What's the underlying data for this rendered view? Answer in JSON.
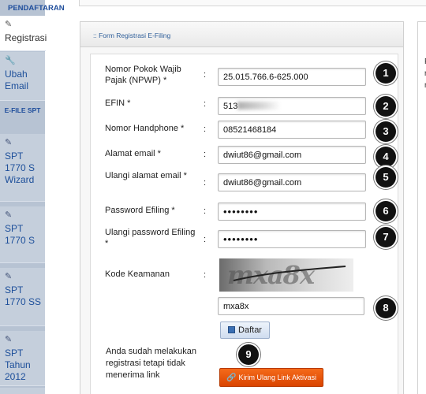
{
  "sidebar": {
    "header": "PENDAFTARAN",
    "items": [
      {
        "icon": "edit-icon",
        "label": "Registrasi",
        "active": true
      },
      {
        "icon": "wrench-icon",
        "label": "Ubah Email",
        "active": false
      },
      {
        "icon": "edit-icon",
        "label": "SPT 1770 S Wizard",
        "active": false
      },
      {
        "icon": "edit-icon",
        "label": "SPT 1770 S",
        "active": false
      },
      {
        "icon": "edit-icon",
        "label": "SPT 1770 SS",
        "active": false
      },
      {
        "icon": "edit-icon",
        "label": "SPT Tahun 2012",
        "active": false
      }
    ],
    "section_label": "E-FILE SPT"
  },
  "panel": {
    "title": ":: Form Registrasi E-Filing"
  },
  "form": {
    "colon": ":",
    "fields": [
      {
        "label": "Nomor Pokok Wajib Pajak (NPWP) *",
        "value": "25.015.766.6-625.000",
        "marker": "1"
      },
      {
        "label": "EFIN *",
        "value": "513",
        "marker": "2"
      },
      {
        "label": "Nomor Handphone *",
        "value": "08521468184",
        "marker": "3"
      },
      {
        "label": "Alamat email *",
        "value": "dwiut86@gmail.com",
        "marker": "4"
      },
      {
        "label": "Ulangi alamat email *",
        "value": "dwiut86@gmail.com",
        "marker": "5"
      },
      {
        "label": "Password Efiling *",
        "value": "••••••••",
        "marker": "6"
      },
      {
        "label": "Ulangi password Efiling *",
        "value": "••••••••",
        "marker": "7"
      }
    ],
    "captcha_label": "Kode Keamanan",
    "captcha_text": "mxa8x",
    "captcha_input": "mxa8x",
    "captcha_marker": "8",
    "submit_label": "Daftar",
    "resend_note": "Anda sudah melakukan registrasi tetapi tidak menerima link",
    "resend_marker": "9",
    "resend_label": "Kirim Ulang Link Aktivasi"
  },
  "colors": {
    "sidebar_bg": "#b7c3d3",
    "link_blue": "#1d4f9a",
    "marker_bg": "#111111",
    "resend_orange": "#e55510"
  }
}
